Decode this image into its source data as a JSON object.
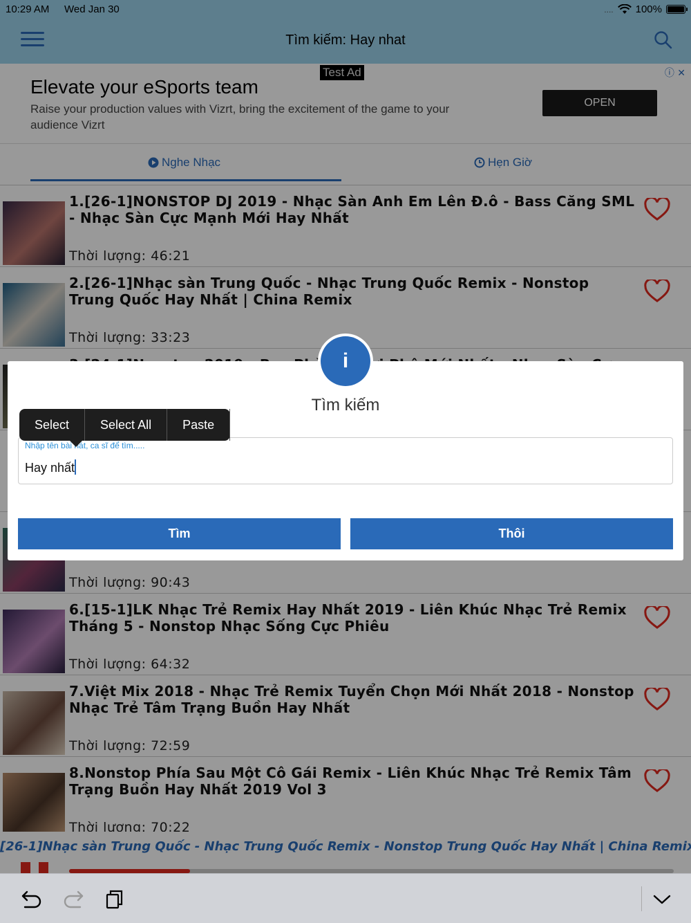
{
  "status_bar": {
    "time": "10:29 AM",
    "date": "Wed Jan 30",
    "signal": "....",
    "battery": "100%"
  },
  "nav": {
    "title": "Tìm kiếm: Hay nhat"
  },
  "ad": {
    "badge": "Test Ad",
    "headline": "Elevate your eSports team",
    "body": "Raise your production values with Vizrt, bring the excitement of the game to your audience Vizrt",
    "open_label": "OPEN"
  },
  "tabs": [
    {
      "label": "Nghe Nhạc",
      "icon": "play-circle-icon",
      "active": true
    },
    {
      "label": "Hẹn Giờ",
      "icon": "clock-icon",
      "active": false
    }
  ],
  "songs": [
    {
      "title": "1.[26-1]NONSTOP DJ 2019 - Nhạc Sàn Anh Em Lên Đ.ô - Bass Căng SML - Nhạc Sàn Cực Mạnh Mới Hay Nhất",
      "duration": "Thời lượng: 46:21"
    },
    {
      "title": "2.[26-1]Nhạc sàn Trung Quốc - Nhạc Trung Quốc Remix - Nonstop Trung Quốc Hay Nhất | China Remix",
      "duration": "Thời lượng: 33:23"
    },
    {
      "title": "3.[24-1]Nonstop 2019 - Bay Phòng Chơi Phê Mới Nhất - Nhạc Sàn Cực",
      "duration": ""
    },
    {
      "title": "",
      "duration": ""
    },
    {
      "title": "",
      "duration": "Thời lượng: 90:43"
    },
    {
      "title": "6.[15-1]LK Nhạc Trẻ Remix Hay Nhất 2019 - Liên Khúc Nhạc Trẻ Remix Tháng 5 - Nonstop Nhạc Sống Cực Phiêu",
      "duration": "Thời lượng: 64:32"
    },
    {
      "title": "7.Việt Mix 2018 - Nhạc Trẻ Remix Tuyển Chọn Mới Nhất 2018 - Nonstop Nhạc Trẻ Tâm Trạng Buồn Hay Nhất",
      "duration": "Thời lượng: 72:59"
    },
    {
      "title": "8.Nonstop Phía Sau Một Cô Gái Remix - Liên Khúc Nhạc Trẻ Remix Tâm Trạng Buồn Hay Nhất 2019 Vol 3",
      "duration": "Thời lượng: 70:22"
    }
  ],
  "now_playing": "[26-1]Nhạc sàn Trung Quốc - Nhạc Trung Quốc Remix - Nonstop Trung Quốc Hay Nhất | China Remix",
  "playback_progress": 0.2,
  "dialog": {
    "title": "Tìm kiếm",
    "field_label": "Nhập tên bài hát, ca sĩ để tìm.....",
    "field_value": "Hay nhất",
    "search_label": "Tìm",
    "cancel_label": "Thôi"
  },
  "edit_menu": [
    "Select",
    "Select All",
    "Paste"
  ],
  "colors": {
    "accent": "#2a6ab8",
    "nav_bg": "#9bd3ec",
    "heart": "#e0281e"
  }
}
